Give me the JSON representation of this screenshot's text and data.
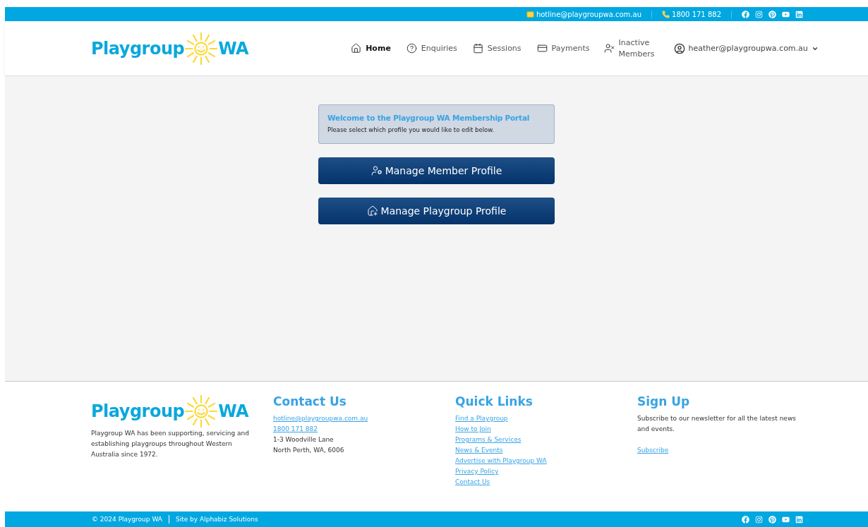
{
  "top_bar": {
    "email": "hotline@playgroupwa.com.au",
    "phone": "1800 171 882"
  },
  "header": {
    "logo": {
      "left": "Playgroup",
      "right": "WA"
    },
    "nav": [
      {
        "kind": "home",
        "label": "Home",
        "selected": true
      },
      {
        "kind": "help",
        "label": "Enquiries",
        "selected": false
      },
      {
        "kind": "calendar",
        "label": "Sessions",
        "selected": false
      },
      {
        "kind": "card",
        "label": "Payments",
        "selected": false
      },
      {
        "kind": "inactive",
        "label": "Inactive Members",
        "selected": false
      }
    ],
    "user": "heather@playgroupwa.com.au"
  },
  "welcome": {
    "title": "Welcome to the Playgroup WA Membership Portal",
    "text": "Please select which profile you would like to edit below."
  },
  "buttons": [
    {
      "kind": "member",
      "label": "Manage Member Profile"
    },
    {
      "kind": "playgroup",
      "label": "Manage Playgroup Profile"
    }
  ],
  "footer": {
    "logo": {
      "left": "Playgroup",
      "right": "WA"
    },
    "about": "Playgroup WA has been supporting, servicing and establishing playgroups throughout Western Australia since 1972.",
    "contact": {
      "title": "Contact Us",
      "links": [
        "hotline@playgroupwa.com.au",
        "1800 171 882"
      ],
      "lines": [
        "1-3 Woodville Lane",
        "North Perth, WA, 6006"
      ]
    },
    "quick_links": {
      "title": "Quick Links",
      "links": [
        "Find a Playgroup",
        "How to Join",
        "Programs & Services",
        "News & Events",
        "Advertise with Playgroup WA",
        "Privacy Policy",
        "Contact Us"
      ]
    },
    "sign_up": {
      "title": "Sign Up",
      "text": "Subscribe to our newsletter for all the latest news and events.",
      "link": "Subscribe"
    }
  },
  "bottom_bar": {
    "copyright": "© 2024 Playgroup WA",
    "credit": "Site by Alphabiz Solutions"
  }
}
